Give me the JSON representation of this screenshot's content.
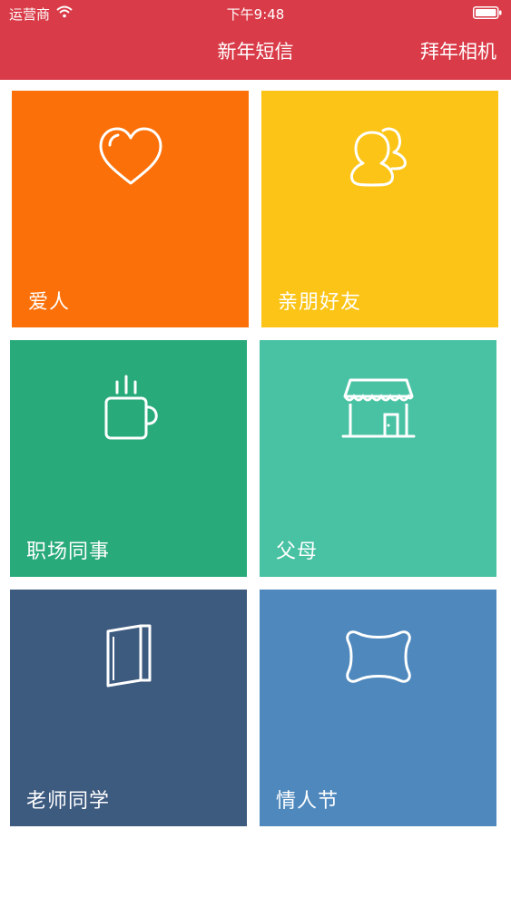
{
  "status_bar": {
    "carrier": "运营商",
    "time": "下午9:48"
  },
  "nav": {
    "title": "新年短信",
    "right_button": "拜年相机"
  },
  "colors": {
    "header_bg": "#d93b48",
    "lover": "#fb7009",
    "friends": "#fbc416",
    "colleagues": "#29aa7b",
    "parents": "#49c2a4",
    "teachers": "#3d5a7f",
    "valentine": "#4e88bd"
  },
  "categories": [
    {
      "label": "爱人",
      "icon": "heart-icon"
    },
    {
      "label": "亲朋好友",
      "icon": "friends-icon"
    },
    {
      "label": "职场同事",
      "icon": "coffee-mug-icon"
    },
    {
      "label": "父母",
      "icon": "shop-icon"
    },
    {
      "label": "老师同学",
      "icon": "book-icon"
    },
    {
      "label": "情人节",
      "icon": "pillow-icon"
    }
  ]
}
